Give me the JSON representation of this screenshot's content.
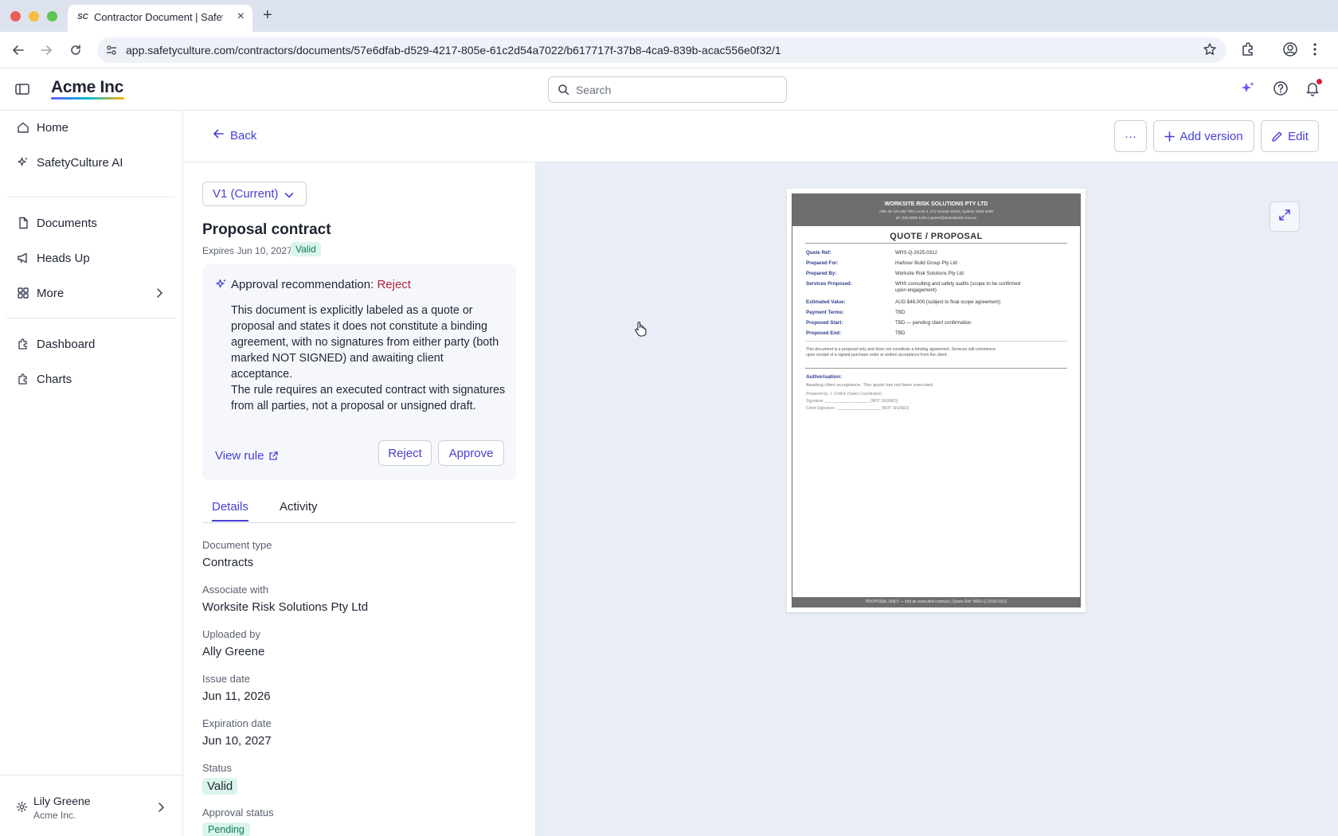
{
  "browser": {
    "tab_title": "Contractor Document | SafetyCulture",
    "tab_favicon": "SC",
    "url": "app.safetyculture.com/contractors/documents/57e6dfab-d529-4217-805e-61c2d54a7022/b617717f-37b8-4ca9-839b-acac556e0f32/1"
  },
  "header": {
    "brand": "Acme Inc",
    "search_placeholder": "Search"
  },
  "sidebar": {
    "items": [
      {
        "label": "Home",
        "icon": "home-icon"
      },
      {
        "label": "SafetyCulture AI",
        "icon": "sparkle-icon"
      },
      {
        "label": "Documents",
        "icon": "document-icon"
      },
      {
        "label": "Heads Up",
        "icon": "megaphone-icon"
      },
      {
        "label": "More",
        "icon": "grid-icon"
      },
      {
        "label": "Dashboard",
        "icon": "puzzle-icon"
      },
      {
        "label": "Charts",
        "icon": "puzzle-icon"
      }
    ],
    "user": {
      "name": "Lily Greene",
      "org": "Acme Inc."
    }
  },
  "page": {
    "back_label": "Back",
    "more_label": "···",
    "add_version_label": "Add version",
    "edit_label": "Edit"
  },
  "document": {
    "version": "V1 (Current)",
    "title": "Proposal contract",
    "expiry": "Expires Jun 10, 2027",
    "status_badge": "Valid"
  },
  "ai_card": {
    "heading": "Approval recommendation:",
    "recommendation": "Reject",
    "paragraph1": "This document is explicitly labeled as a quote or proposal and states it does not constitute a binding agreement, with no signatures from either party (both marked NOT SIGNED) and awaiting client acceptance.",
    "paragraph2": "The rule requires an executed contract with signatures from all parties, not a proposal or unsigned draft.",
    "view_rule_label": "View rule",
    "reject_label": "Reject",
    "approve_label": "Approve"
  },
  "tabs": [
    {
      "label": "Details",
      "active": true
    },
    {
      "label": "Activity",
      "active": false
    }
  ],
  "details": [
    {
      "label": "Document type",
      "value": "Contracts"
    },
    {
      "label": "Associate with",
      "value": "Worksite Risk Solutions Pty Ltd"
    },
    {
      "label": "Uploaded by",
      "value": "Ally Greene"
    },
    {
      "label": "Issue date",
      "value": "Jun 11, 2026"
    },
    {
      "label": "Expiration date",
      "value": "Jun 10, 2027"
    },
    {
      "label": "Status",
      "value": "Valid"
    },
    {
      "label": "Approval status",
      "value": "Pending"
    }
  ],
  "preview": {
    "company": "WORKSITE RISK SOLUTIONS PTY LTD",
    "address": "ABN 45 123 456 789  |  Level 4, 210 George Street, Sydney NSW 2000",
    "contact": "ph: (02) 8000 1234  |  quotes@worksiterisk.com.au",
    "title": "QUOTE / PROPOSAL",
    "rows": [
      {
        "label": "Quote Ref:",
        "value": "WRS-Q-2025-0312"
      },
      {
        "label": "Prepared For:",
        "value": "Harbour Build Group Pty Ltd"
      },
      {
        "label": "Prepared By:",
        "value": "Worksite Risk Solutions Pty Ltd"
      },
      {
        "label": "Services Proposed:",
        "value": "WHS consulting and safety audits (scope to be confirmed upon engagement)"
      },
      {
        "label": "Estimated Value:",
        "value": "AUD $48,000 (subject to final scope agreement)"
      },
      {
        "label": "Payment Terms:",
        "value": "TBD"
      },
      {
        "label": "Proposed Start:",
        "value": "TBD — pending client confirmation"
      },
      {
        "label": "Proposed End:",
        "value": "TBD"
      }
    ],
    "disclaimer": "This document is a proposal only and does not constitute a binding agreement. Services will commence upon receipt of a signed purchase order or written acceptance from the client.",
    "auth_heading": "Authorisation:",
    "auth_text": "Awaiting client acceptance. This quote has not been executed.",
    "prepared_by": "Prepared by: J. Collins (Sales Coordinator)",
    "signature": "Signature: ____________________  [NOT SIGNED]",
    "client_signature": "Client Signature: ____________________  [NOT SIGNED]",
    "footer": "PROPOSAL ONLY — Not an executed contract  |  Quote Ref: WRS-Q-2025-0312"
  },
  "colors": {
    "accent": "#4740d4",
    "reject": "#b4233c",
    "valid_bg": "#daf5ec",
    "valid_text": "#0f7a55",
    "preview_bg": "#e9edf6"
  }
}
